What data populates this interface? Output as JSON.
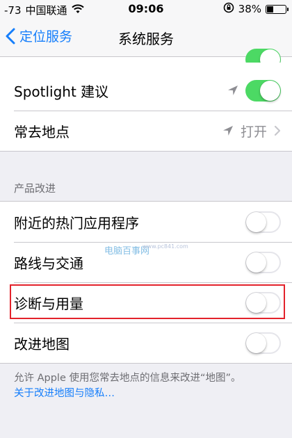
{
  "status_bar": {
    "signal": "-73",
    "carrier": "中国联通",
    "time": "09:06",
    "battery_percent": "38%",
    "battery_level": 0.38
  },
  "nav": {
    "back_label": "定位服务",
    "title": "系统服务"
  },
  "top_group": [
    {
      "label": "Spotlight 建议",
      "location_arrow": true,
      "toggle_on": true
    },
    {
      "label": "常去地点",
      "location_arrow": true,
      "value": "打开",
      "chevron": true
    }
  ],
  "section_header": "产品改进",
  "product_group": [
    {
      "label": "附近的热门应用程序",
      "toggle_on": false
    },
    {
      "label": "路线与交通",
      "toggle_on": false
    },
    {
      "label": "诊断与用量",
      "toggle_on": false
    },
    {
      "label": "改进地图",
      "toggle_on": false
    }
  ],
  "footer": {
    "text": "允许 Apple 使用您常去地点的信息来改进“地图”。",
    "link": "关于改进地图与隐私…"
  },
  "watermark": {
    "text": "电脑百事网",
    "url": "www.pc841.com"
  },
  "colors": {
    "accent": "#157efb",
    "toggle_on": "#4cd964",
    "highlight": "#e3222b"
  }
}
